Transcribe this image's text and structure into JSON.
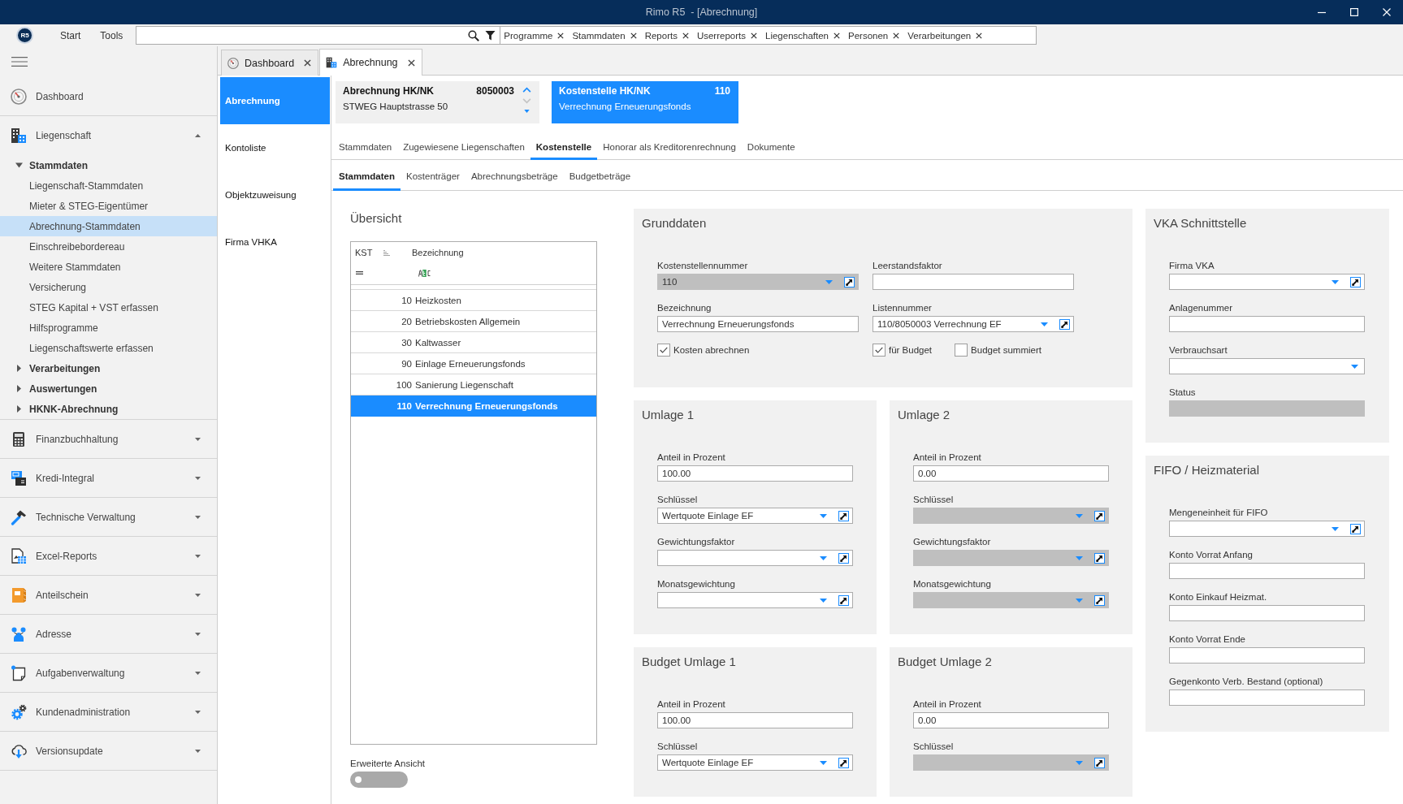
{
  "window": {
    "title": "Rimo R5  - [Abrechnung]"
  },
  "toolbar": {
    "logo": "R5",
    "menus": [
      "Start",
      "Tools"
    ],
    "quick_tags": [
      "Programme",
      "Stammdaten",
      "Reports",
      "Userreports",
      "Liegenschaften",
      "Personen",
      "Verarbeitungen"
    ]
  },
  "tabs": [
    {
      "label": "Dashboard",
      "selected": false
    },
    {
      "label": "Abrechnung",
      "selected": true
    }
  ],
  "sidebar": {
    "items": [
      {
        "label": "Dashboard",
        "kind": "link"
      },
      {
        "label": "Liegenschaft",
        "kind": "group",
        "expanded": true,
        "children": [
          {
            "label": "Stammdaten",
            "expanded": true,
            "children": [
              {
                "label": "Liegenschaft-Stammdaten",
                "selected": false
              },
              {
                "label": "Mieter & STEG-Eigentümer",
                "selected": false
              },
              {
                "label": "Abrechnung-Stammdaten",
                "selected": true
              },
              {
                "label": "Einschreibebordereau",
                "selected": false
              },
              {
                "label": "Weitere Stammdaten",
                "selected": false
              },
              {
                "label": "Versicherung",
                "selected": false
              },
              {
                "label": "STEG Kapital + VST erfassen",
                "selected": false
              },
              {
                "label": "Hilfsprogramme",
                "selected": false
              },
              {
                "label": "Liegenschaftswerte erfassen",
                "selected": false
              }
            ]
          },
          {
            "label": "Verarbeitungen",
            "expanded": false
          },
          {
            "label": "Auswertungen",
            "expanded": false
          },
          {
            "label": "HKNK-Abrechnung",
            "expanded": false
          }
        ]
      },
      {
        "label": "Finanzbuchhaltung",
        "kind": "group",
        "expanded": false
      },
      {
        "label": "Kredi-Integral",
        "kind": "group",
        "expanded": false
      },
      {
        "label": "Technische Verwaltung",
        "kind": "group",
        "expanded": false
      },
      {
        "label": "Excel-Reports",
        "kind": "group",
        "expanded": false
      },
      {
        "label": "Anteilschein",
        "kind": "group",
        "expanded": false
      },
      {
        "label": "Adresse",
        "kind": "group",
        "expanded": false
      },
      {
        "label": "Aufgabenverwaltung",
        "kind": "group",
        "expanded": false
      },
      {
        "label": "Kundenadministration",
        "kind": "group",
        "expanded": false
      },
      {
        "label": "Versionsupdate",
        "kind": "group",
        "expanded": false
      }
    ]
  },
  "record_nav": [
    {
      "label": "Abrechnung",
      "selected": true
    },
    {
      "label": "Kontoliste",
      "selected": false
    },
    {
      "label": "Objektzuweisung",
      "selected": false
    },
    {
      "label": "Firma VHKA",
      "selected": false
    }
  ],
  "header": {
    "record": {
      "title": "Abrechnung HK/NK",
      "number": "8050003",
      "subtitle": "STWEG Hauptstrasse 50",
      "previous_disabled": false,
      "next_disabled": true
    },
    "cost_center": {
      "title": "Kostenstelle HK/NK",
      "number": "110",
      "subtitle": "Verrechnung Erneuerungsfonds"
    }
  },
  "section_tabs": [
    {
      "label": "Stammdaten",
      "selected": false
    },
    {
      "label": "Zugewiesene Liegenschaften",
      "selected": false
    },
    {
      "label": "Kostenstelle",
      "selected": true
    },
    {
      "label": "Honorar als Kreditorenrechnung",
      "selected": false
    },
    {
      "label": "Dokumente",
      "selected": false
    }
  ],
  "sub_tabs": [
    {
      "label": "Stammdaten",
      "selected": true
    },
    {
      "label": "Kostenträger",
      "selected": false
    },
    {
      "label": "Abrechnungsbeträge",
      "selected": false
    },
    {
      "label": "Budgetbeträge",
      "selected": false
    }
  ],
  "overview": {
    "title": "Übersicht",
    "columns": [
      "KST",
      "Bezeichnung"
    ],
    "rows": [
      {
        "kst": "10",
        "name": "Heizkosten",
        "selected": false
      },
      {
        "kst": "20",
        "name": "Betriebskosten Allgemein",
        "selected": false
      },
      {
        "kst": "30",
        "name": "Kaltwasser",
        "selected": false
      },
      {
        "kst": "90",
        "name": "Einlage Erneuerungsfonds",
        "selected": false
      },
      {
        "kst": "100",
        "name": "Sanierung Liegenschaft",
        "selected": false
      },
      {
        "kst": "110",
        "name": "Verrechnung Erneuerungsfonds",
        "selected": true
      }
    ],
    "option": {
      "label": "Erweiterte Ansicht",
      "on": false
    }
  },
  "grunddaten": {
    "title": "Grunddaten",
    "fields": [
      {
        "label": "Kostenstellennummer",
        "kind": "lookup",
        "value": "110",
        "disabled": true
      },
      {
        "label": "Leerstandsfaktor",
        "kind": "text",
        "disabled": false
      },
      {
        "label": "Bezeichnung",
        "kind": "text",
        "value": "Verrechnung Erneuerungsfonds",
        "disabled": false
      },
      {
        "label": "Listennummer",
        "kind": "lookup",
        "value": "110/8050003 Verrechnung EF",
        "disabled": false
      }
    ],
    "checkbox_columns": [
      [
        {
          "label": "Kosten abrechnen",
          "checked": true
        }
      ],
      [
        {
          "label": "für Budget",
          "checked": true
        },
        {
          "label": "Budget summiert",
          "checked": false
        }
      ]
    ]
  },
  "allocations": [
    {
      "title": "Umlage 1",
      "fields": [
        {
          "label": "Anteil in Prozent",
          "kind": "text",
          "value": "100.00",
          "disabled": false
        },
        {
          "label": "Schlüssel",
          "kind": "lookup",
          "value": "Wertquote Einlage EF",
          "disabled": false
        },
        {
          "label": "Gewichtungsfaktor",
          "kind": "lookup",
          "disabled": false
        },
        {
          "label": "Monatsgewichtung",
          "kind": "lookup",
          "disabled": false
        }
      ]
    },
    {
      "title": "Umlage 2",
      "fields": [
        {
          "label": "Anteil in Prozent",
          "kind": "text",
          "value": "0.00",
          "disabled": false
        },
        {
          "label": "Schlüssel",
          "kind": "lookup",
          "disabled": true
        },
        {
          "label": "Gewichtungsfaktor",
          "kind": "lookup",
          "disabled": true
        },
        {
          "label": "Monatsgewichtung",
          "kind": "lookup",
          "disabled": true
        }
      ]
    },
    {
      "title": "Budget Umlage 1",
      "fields": [
        {
          "label": "Anteil in Prozent",
          "kind": "text",
          "value": "100.00",
          "disabled": false
        },
        {
          "label": "Schlüssel",
          "kind": "lookup",
          "value": "Wertquote Einlage EF",
          "disabled": false
        }
      ]
    },
    {
      "title": "Budget Umlage 2",
      "fields": [
        {
          "label": "Anteil in Prozent",
          "kind": "text",
          "value": "0.00",
          "disabled": false
        },
        {
          "label": "Schlüssel",
          "kind": "lookup",
          "disabled": true
        }
      ]
    }
  ],
  "side_panels": [
    {
      "title": "VKA Schnittstelle",
      "fields": [
        {
          "label": "Firma VKA",
          "kind": "lookup",
          "disabled": false
        },
        {
          "label": "Anlagenummer",
          "kind": "text",
          "disabled": false
        },
        {
          "label": "Verbrauchsart",
          "kind": "combo",
          "disabled": false
        },
        {
          "label": "Status",
          "kind": "text",
          "disabled": true
        }
      ]
    },
    {
      "title": "FIFO / Heizmaterial",
      "fields": [
        {
          "label": "Mengeneinheit für FIFO",
          "kind": "lookup",
          "disabled": false
        },
        {
          "label": "Konto Vorrat Anfang",
          "kind": "text",
          "disabled": false
        },
        {
          "label": "Konto Einkauf Heizmat.",
          "kind": "text",
          "disabled": false
        },
        {
          "label": "Konto Vorrat Ende",
          "kind": "text",
          "disabled": false
        },
        {
          "label": "Gegenkonto Verb. Bestand (optional)",
          "kind": "text",
          "disabled": false
        }
      ]
    }
  ]
}
